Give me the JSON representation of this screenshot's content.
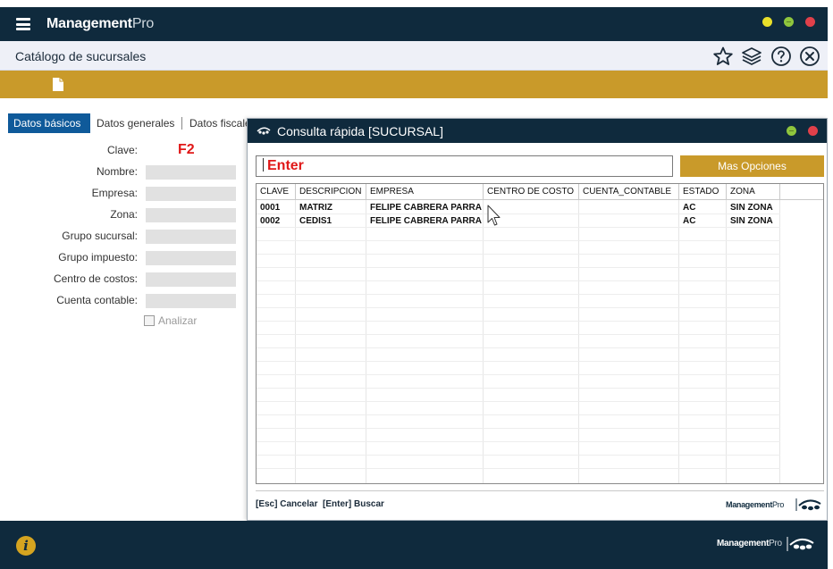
{
  "app": {
    "brand_main": "Management",
    "brand_pro": "Pro",
    "page_title": "Catálogo de sucursales"
  },
  "header_icons": [
    "star-icon",
    "layers-icon",
    "help-icon",
    "close-icon"
  ],
  "toolbar": {
    "new_icon": "new-document-icon"
  },
  "tabs": [
    {
      "label": "Datos básicos",
      "active": true
    },
    {
      "label": "Datos generales",
      "active": false
    },
    {
      "label": "Datos fiscales",
      "active": false
    }
  ],
  "form": {
    "fields": [
      {
        "label": "Clave:",
        "value": "F2"
      },
      {
        "label": "Nombre:",
        "value": ""
      },
      {
        "label": "Empresa:",
        "value": ""
      },
      {
        "label": "Zona:",
        "value": ""
      },
      {
        "label": "Grupo sucursal:",
        "value": ""
      },
      {
        "label": "Grupo impuesto:",
        "value": ""
      },
      {
        "label": "Centro de costos:",
        "value": ""
      },
      {
        "label": "Cuenta contable:",
        "value": ""
      }
    ],
    "checkbox_label": "Analizar"
  },
  "dialog": {
    "title": "Consulta rápida [SUCURSAL]",
    "search_value": "Enter",
    "more_options_label": "Mas Opciones",
    "columns": [
      "CLAVE",
      "DESCRIPCION",
      "EMPRESA",
      "CENTRO DE COSTO",
      "CUENTA_CONTABLE",
      "ESTADO",
      "ZONA"
    ],
    "rows": [
      [
        "0001",
        "MATRIZ",
        "FELIPE CABRERA PARRA",
        "",
        "",
        "AC",
        "SIN ZONA"
      ],
      [
        "0002",
        "CEDIS1",
        "FELIPE CABRERA PARRA",
        "",
        "",
        "AC",
        "SIN ZONA"
      ]
    ],
    "hint_esc": "[Esc] Cancelar",
    "hint_enter": "[Enter] Buscar",
    "brand_main": "Management",
    "brand_pro": "Pro"
  },
  "footer": {
    "brand_main": "Management",
    "brand_pro": "Pro",
    "info_glyph": "i"
  },
  "colors": {
    "navy": "#0f2a3d",
    "gold": "#c99a2a",
    "tab_active": "#0f5a9a",
    "accent_red": "#e01818"
  }
}
